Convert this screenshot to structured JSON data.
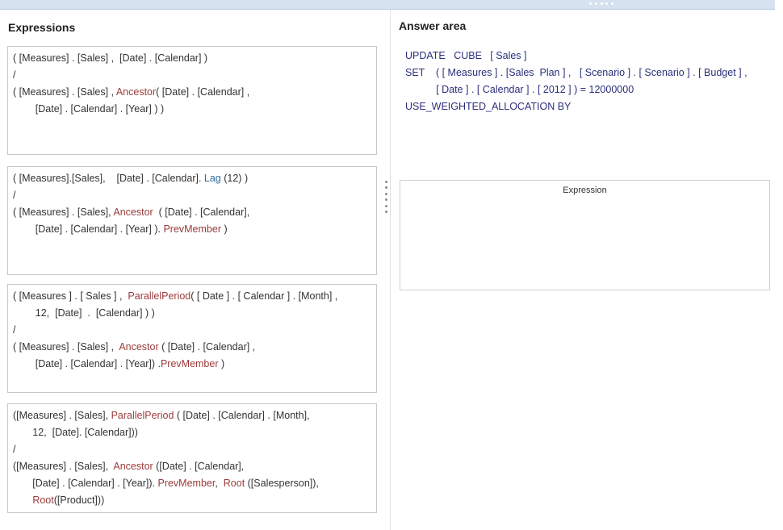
{
  "left_panel": {
    "heading": "Expressions",
    "expressions": [
      {
        "lines": [
          [
            {
              "t": "( [Measures] . [Sales] ,  [Date] . [Calendar] )",
              "c": "plain"
            }
          ],
          [
            {
              "t": "/",
              "c": "plain"
            }
          ],
          [
            {
              "t": "( [Measures] . [Sales] , ",
              "c": "plain"
            },
            {
              "t": "Ancestor",
              "c": "fn"
            },
            {
              "t": "( [Date] . [Calendar] ,",
              "c": "plain"
            }
          ],
          [
            {
              "t": "        [Date] . [Calendar] . [Year] ) )",
              "c": "plain"
            }
          ]
        ]
      },
      {
        "lines": [
          [
            {
              "t": "( [Measures].[Sales],    [Date] . [Calendar]. ",
              "c": "plain"
            },
            {
              "t": "Lag",
              "c": "fn-blue"
            },
            {
              "t": " (12) )",
              "c": "plain"
            }
          ],
          [
            {
              "t": "/",
              "c": "plain"
            }
          ],
          [
            {
              "t": "( [Measures] . [Sales], ",
              "c": "plain"
            },
            {
              "t": "Ancestor",
              "c": "fn"
            },
            {
              "t": "  ( [Date] . [Calendar],",
              "c": "plain"
            }
          ],
          [
            {
              "t": "        [Date] . [Calendar] . [Year] ). ",
              "c": "plain"
            },
            {
              "t": "PrevMember",
              "c": "fn"
            },
            {
              "t": " )",
              "c": "plain"
            }
          ]
        ]
      },
      {
        "lines": [
          [
            {
              "t": "( [Measures ] . [ Sales ] ,  ",
              "c": "plain"
            },
            {
              "t": "ParallelPeriod",
              "c": "fn"
            },
            {
              "t": "( [ Date ] . [ Calendar ] . [Month] ,",
              "c": "plain"
            }
          ],
          [
            {
              "t": "        12,  [Date]  .  [Calendar] ) )",
              "c": "plain"
            }
          ],
          [
            {
              "t": "/",
              "c": "plain"
            }
          ],
          [
            {
              "t": "( [Measures] . [Sales] ,  ",
              "c": "plain"
            },
            {
              "t": "Ancestor",
              "c": "fn"
            },
            {
              "t": " ( [Date] . [Calendar] ,",
              "c": "plain"
            }
          ],
          [
            {
              "t": "        [Date] . [Calendar] . [Year]) .",
              "c": "plain"
            },
            {
              "t": "PrevMember",
              "c": "fn"
            },
            {
              "t": " )",
              "c": "plain"
            }
          ]
        ]
      },
      {
        "lines": [
          [
            {
              "t": "([Measures] . [Sales], ",
              "c": "plain"
            },
            {
              "t": "ParallelPeriod",
              "c": "fn"
            },
            {
              "t": " ( [Date] . [Calendar] . [Month],",
              "c": "plain"
            }
          ],
          [
            {
              "t": "       12,  [Date]. [Calendar]))",
              "c": "plain"
            }
          ],
          [
            {
              "t": "/",
              "c": "plain"
            }
          ],
          [
            {
              "t": "([Measures] . [Sales],  ",
              "c": "plain"
            },
            {
              "t": "Ancestor",
              "c": "fn"
            },
            {
              "t": " ([Date] . [Calendar],",
              "c": "plain"
            }
          ],
          [
            {
              "t": "       [Date] . [Calendar] . [Year]). ",
              "c": "plain"
            },
            {
              "t": "PrevMember",
              "c": "fn"
            },
            {
              "t": ",  ",
              "c": "plain"
            },
            {
              "t": "Root",
              "c": "fn"
            },
            {
              "t": " ([Salesperson]),",
              "c": "plain"
            }
          ],
          [
            {
              "t": "       ",
              "c": "plain"
            },
            {
              "t": "Root",
              "c": "fn"
            },
            {
              "t": "([Product]))",
              "c": "plain"
            }
          ]
        ]
      }
    ]
  },
  "right_panel": {
    "heading": "Answer area",
    "code_lines": [
      "UPDATE   CUBE   [ Sales ]",
      "SET    ( [ Measures ] . [Sales  Plan ] ,   [ Scenario ] . [ Scenario ] . [ Budget ] ,",
      "           [ Date ] . [ Calendar ] . [ 2012 ] ) = 12000000",
      "USE_WEIGHTED_ALLOCATION BY"
    ],
    "drop_zone_label": "Expression"
  },
  "colors": {
    "function_red": "#9b3b3b",
    "function_blue": "#2f6da0",
    "code_navy": "#2b2f7a",
    "topbar": "#d6e2f0"
  }
}
